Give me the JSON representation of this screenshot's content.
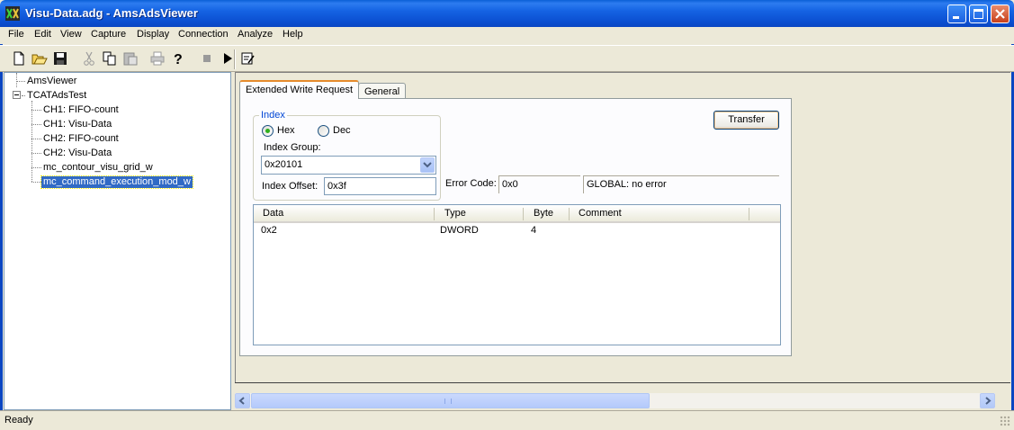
{
  "window": {
    "title": "Visu-Data.adg - AmsAdsViewer"
  },
  "menu": [
    "File",
    "Edit",
    "View",
    "Capture",
    "Display",
    "Connection",
    "Analyze",
    "Help"
  ],
  "toolbar": {
    "icons": [
      "new-icon",
      "open-icon",
      "save-icon",
      "cut-icon",
      "copy-icon",
      "paste-icon",
      "print-icon",
      "help-icon",
      "stop-icon",
      "play-icon",
      "write-request-icon"
    ]
  },
  "tree": {
    "root": "AmsViewer",
    "group": "TCATAdsTest",
    "items": [
      "CH1: FIFO-count",
      "CH1: Visu-Data",
      "CH2: FIFO-count",
      "CH2: Visu-Data",
      "mc_contour_visu_grid_w",
      "mc_command_execution_mod_w"
    ],
    "selected_index": 5
  },
  "tabs": [
    "Extended Write Request",
    "General"
  ],
  "index": {
    "legend": "Index",
    "hex_label": "Hex",
    "dec_label": "Dec",
    "selected_radix": "Hex",
    "group_label": "Index Group:",
    "group_value": "0x20101",
    "offset_label": "Index Offset:",
    "offset_value": "0x3f"
  },
  "transfer_button": "Transfer",
  "error": {
    "label": "Error Code:",
    "code": "0x0",
    "message": "GLOBAL: no error"
  },
  "list": {
    "columns": [
      "Data",
      "Type",
      "Byte",
      "Comment"
    ],
    "rows": [
      {
        "data": "0x2",
        "type": "DWORD",
        "byte": "4",
        "comment": ""
      }
    ]
  },
  "status": {
    "text": "Ready"
  },
  "colors": {
    "titlebar": "#0a5fd6",
    "selection": "#316ac5",
    "tab_accent": "#e68b2c"
  }
}
